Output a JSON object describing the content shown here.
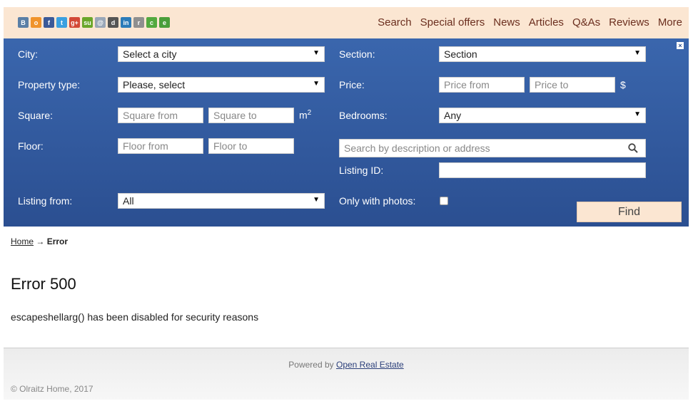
{
  "colors": {
    "topbar": "#fbe6d2",
    "panel": "#2b4f91",
    "nav_link": "#6b2e1e",
    "find_btn": "#fbe6d2"
  },
  "social_icons": [
    {
      "name": "vkontakte-icon",
      "glyph": "B",
      "color": "#5a7fa6"
    },
    {
      "name": "odnoklassniki-icon",
      "glyph": "o",
      "color": "#f0932b"
    },
    {
      "name": "facebook-icon",
      "glyph": "f",
      "color": "#3b5998"
    },
    {
      "name": "twitter-icon",
      "glyph": "t",
      "color": "#3aa0e0"
    },
    {
      "name": "googleplus-icon",
      "glyph": "g+",
      "color": "#d34836"
    },
    {
      "name": "stumbleupon-icon",
      "glyph": "su",
      "color": "#6aa62a"
    },
    {
      "name": "mailru-icon",
      "glyph": "@",
      "color": "#9aa7b8"
    },
    {
      "name": "delicious-icon",
      "glyph": "d",
      "color": "#555555"
    },
    {
      "name": "linkedin-icon",
      "glyph": "in",
      "color": "#2b7bb9"
    },
    {
      "name": "reddit-icon",
      "glyph": "r",
      "color": "#8f8f8f"
    },
    {
      "name": "comment-icon",
      "glyph": "c",
      "color": "#53a93f"
    },
    {
      "name": "evernote-icon",
      "glyph": "e",
      "color": "#4a9e3a"
    }
  ],
  "nav": [
    "Search",
    "Special offers",
    "News",
    "Articles",
    "Q&As",
    "Reviews",
    "More"
  ],
  "filters": {
    "city_label": "City:",
    "city_value": "Select a city",
    "section_label": "Section:",
    "section_value": "Section",
    "property_type_label": "Property type:",
    "property_type_value": "Please, select",
    "price_label": "Price:",
    "price_from": "Price from",
    "price_to": "Price to",
    "price_unit": "$",
    "square_label": "Square:",
    "square_from": "Square from",
    "square_to": "Square to",
    "square_unit": "m",
    "square_unit_exp": "2",
    "bedrooms_label": "Bedrooms:",
    "bedrooms_value": "Any",
    "floor_label": "Floor:",
    "floor_from": "Floor from",
    "floor_to": "Floor to",
    "search_placeholder": "Search by description or address",
    "listing_id_label": "Listing ID:",
    "listing_id_value": "",
    "listing_from_label": "Listing from:",
    "listing_from_value": "All",
    "only_photos_label": "Only with photos:",
    "only_photos_checked": false,
    "find_label": "Find",
    "close_glyph": "×",
    "arrow_glyph": "▼"
  },
  "breadcrumb": {
    "home": "Home",
    "separator": "→",
    "current": "Error"
  },
  "page": {
    "title": "Error 500",
    "message": "escapeshellarg() has been disabled for security reasons"
  },
  "footer": {
    "powered_prefix": "Powered by",
    "powered_link": "Open Real Estate",
    "copyright": "© Olraitz Home, 2017"
  }
}
